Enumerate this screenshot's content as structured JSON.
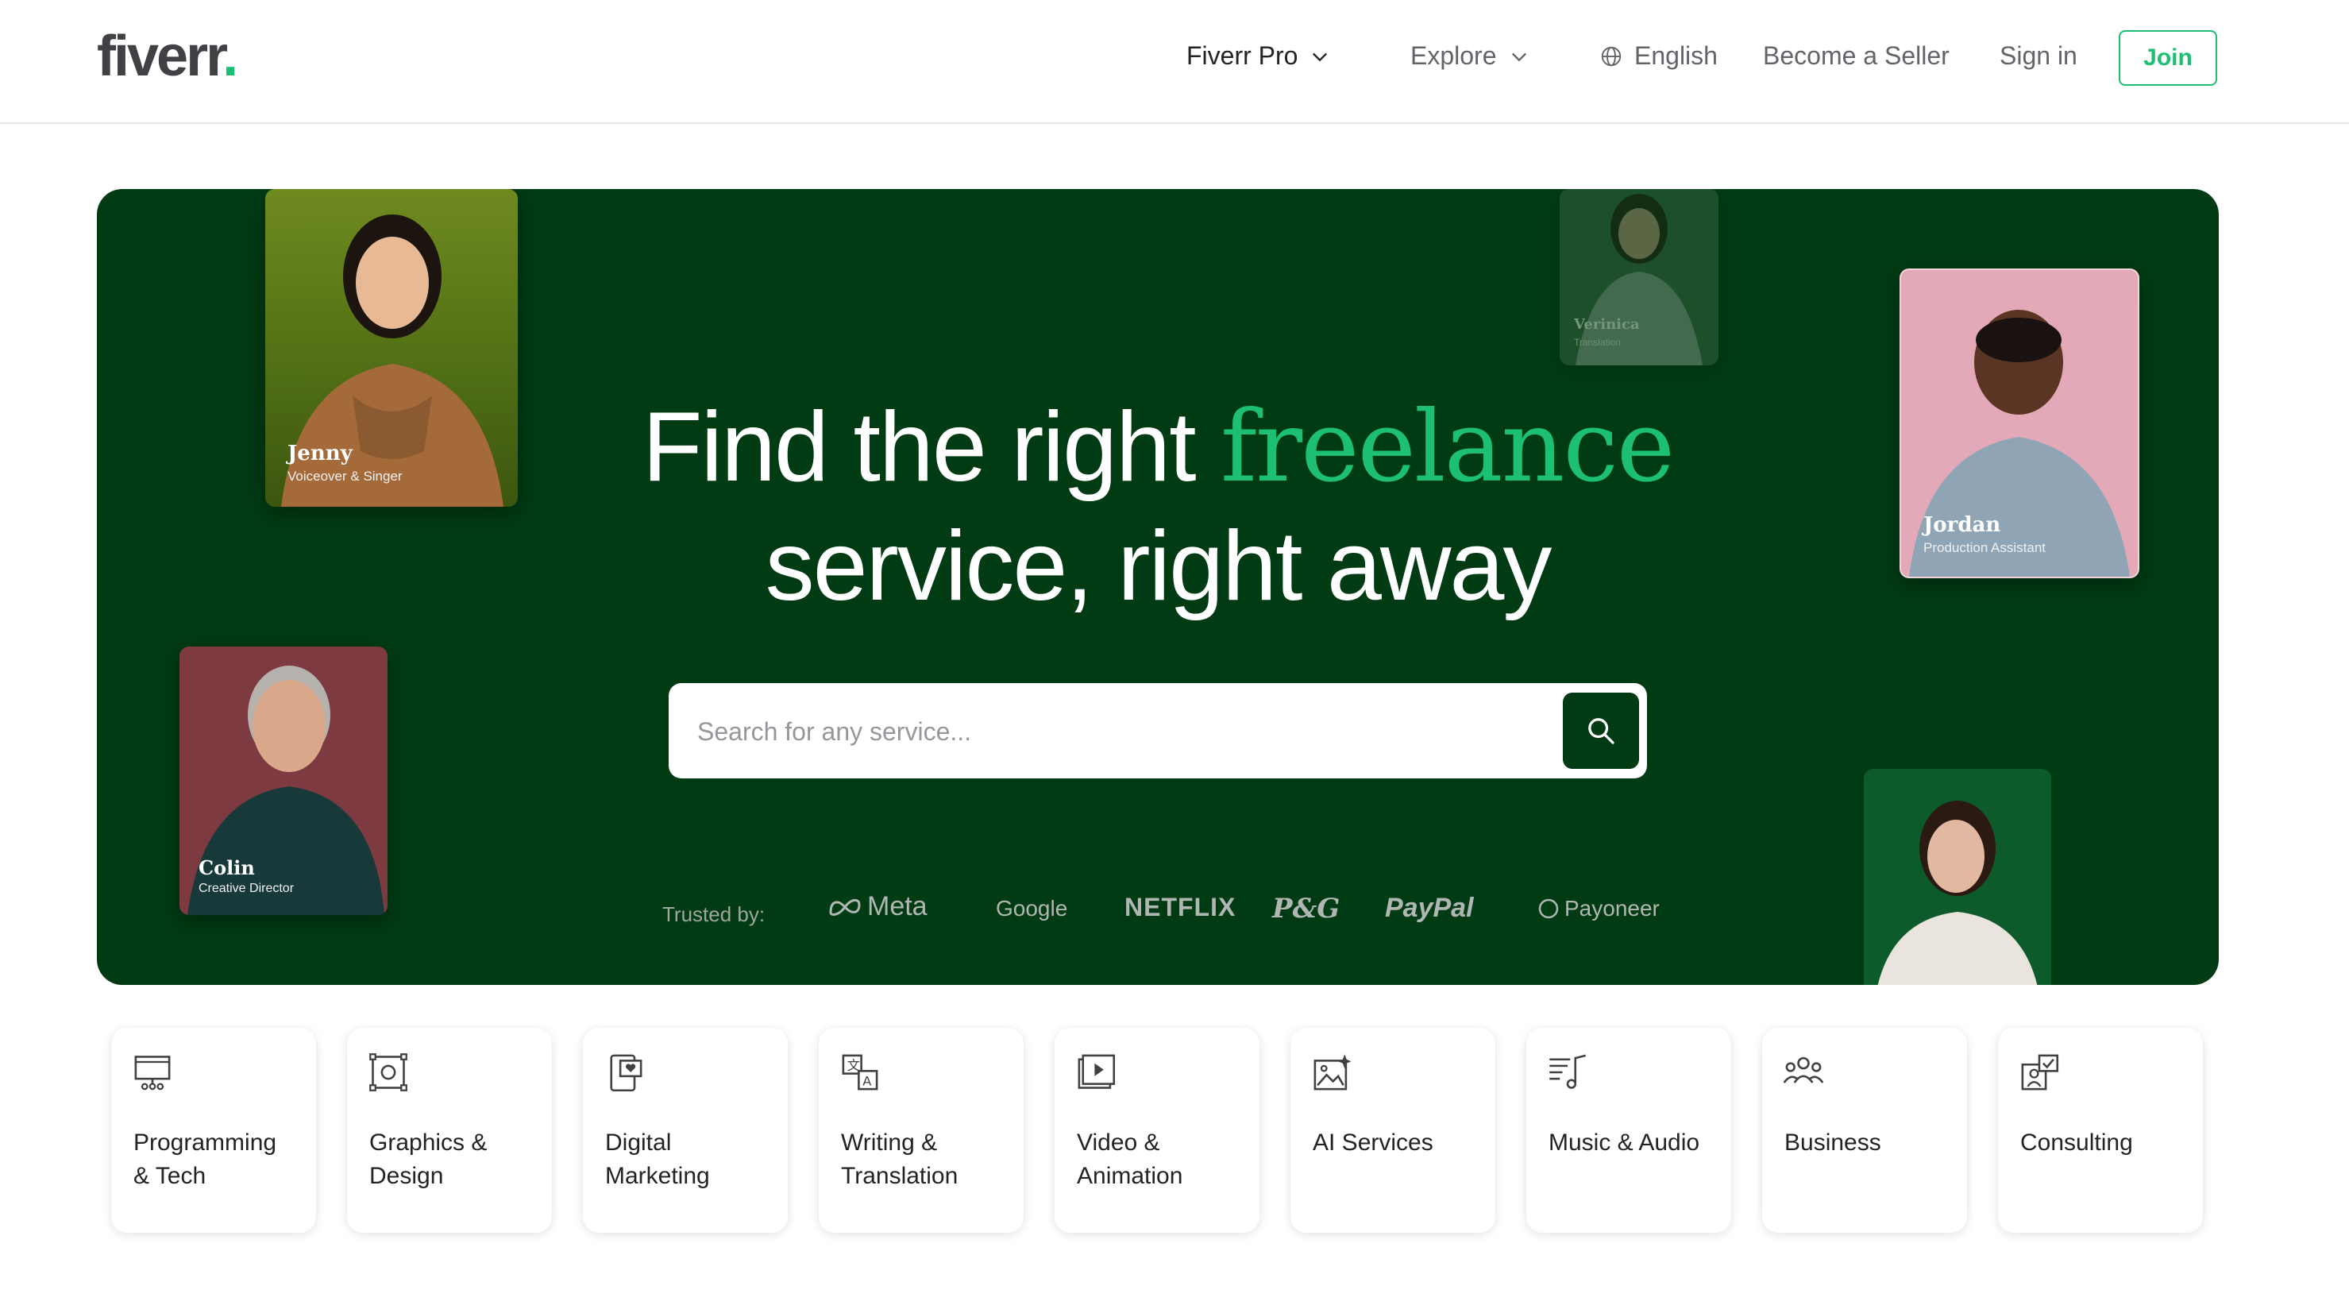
{
  "header": {
    "logo": "fiverr",
    "logo_dot": ".",
    "nav": {
      "fiverr_pro": "Fiverr Pro",
      "explore": "Explore",
      "language": "English",
      "become_seller": "Become a Seller",
      "sign_in": "Sign in",
      "join": "Join"
    }
  },
  "hero": {
    "headline_part1": "Find the right",
    "headline_accent": "freelance",
    "headline_part2": "service, right away",
    "search_placeholder": "Search for any service...",
    "trusted_label": "Trusted by:",
    "brands": [
      "Meta",
      "Google",
      "NETFLIX",
      "P&G",
      "PayPal",
      "Payoneer"
    ],
    "people": [
      {
        "name": "Jenny",
        "role": "Voiceover & Singer"
      },
      {
        "name": "Verinica",
        "role": "Translation"
      },
      {
        "name": "Jordan",
        "role": "Production Assistant"
      },
      {
        "name": "Colin",
        "role": "Creative Director"
      }
    ]
  },
  "categories": [
    {
      "label": "Programming\n& Tech",
      "icon": "monitor-icon"
    },
    {
      "label": "Graphics &\nDesign",
      "icon": "design-frame-icon"
    },
    {
      "label": "Digital\nMarketing",
      "icon": "mobile-heart-icon"
    },
    {
      "label": "Writing &\nTranslation",
      "icon": "translate-icon"
    },
    {
      "label": "Video &\nAnimation",
      "icon": "video-play-icon"
    },
    {
      "label": "AI Services",
      "icon": "ai-image-icon"
    },
    {
      "label": "Music & Audio",
      "icon": "music-note-icon"
    },
    {
      "label": "Business",
      "icon": "people-icon"
    },
    {
      "label": "Consulting",
      "icon": "consulting-icon"
    }
  ],
  "colors": {
    "brand_green": "#1dbf73",
    "hero_bg": "#013b14",
    "text_dark": "#222325"
  }
}
